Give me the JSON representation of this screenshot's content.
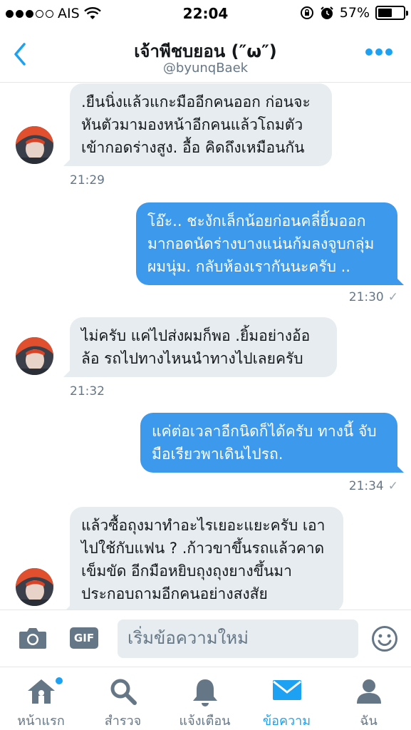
{
  "status_bar": {
    "carrier": "AIS",
    "time": "22:04",
    "battery": "57%",
    "battery_level": 0.57
  },
  "header": {
    "title": "เจ้าพีชบยอน (″ω″)",
    "handle": "@byunqBaek"
  },
  "messages": [
    {
      "direction": "in",
      "text": ".ยืนนิ่งแล้วแกะมืออีกคนออก ก่อนจะหันตัวมามองหน้าอีกคนแล้วโถมตัวเข้ากอดร่างสูง. อื้อ คิดถึงเหมือนกัน",
      "time": "21:29"
    },
    {
      "direction": "out",
      "text": "โอ๊ะ.. ชะงักเล็กน้อยก่อนคลี่ยิ้มออกมากอดนัดร่างบางแน่นก้มลงจูบกลุ่มผมนุ่ม. กลับห้องเรากันนะครับ ..",
      "time": "21:30"
    },
    {
      "direction": "in",
      "text": "ไม่ครับ แค่ไปส่งผมก็พอ .ยิ้มอย่างอ้อล้อ รถไปทางไหนนำทางไปเลยครับ",
      "time": "21:32"
    },
    {
      "direction": "out",
      "text": "แค่ต่อเวลาอีกนิดก็ได้ครับ ทางนี้ จับมือเรียวพาเดินไปรถ.",
      "time": "21:34"
    },
    {
      "direction": "in",
      "text": "แล้วซื้อถุงมาทำอะไรเยอะแยะครับ เอาไปใช้กับแฟน ? .ก้าวขาขึ้นรถแล้วคาดเข็มขัด อีกมือหยิบถุงถุงยางขึ้นมาประกอบถามอีกคนอย่างสงสัย",
      "time": ""
    }
  ],
  "composer": {
    "placeholder": "เริ่มข้อความใหม่",
    "gif_label": "GIF"
  },
  "tabs": [
    {
      "label": "หน้าแรก",
      "icon": "home-icon",
      "active": false
    },
    {
      "label": "สำรวจ",
      "icon": "search-icon",
      "active": false
    },
    {
      "label": "แจ้งเตือน",
      "icon": "bell-icon",
      "active": false
    },
    {
      "label": "ข้อความ",
      "icon": "envelope-icon",
      "active": true
    },
    {
      "label": "ฉัน",
      "icon": "profile-icon",
      "active": false
    }
  ],
  "colors": {
    "accent": "#1da1f2",
    "outgoing_bubble": "#3d99ec",
    "incoming_bubble": "#e6ecf0",
    "muted": "#657786"
  }
}
